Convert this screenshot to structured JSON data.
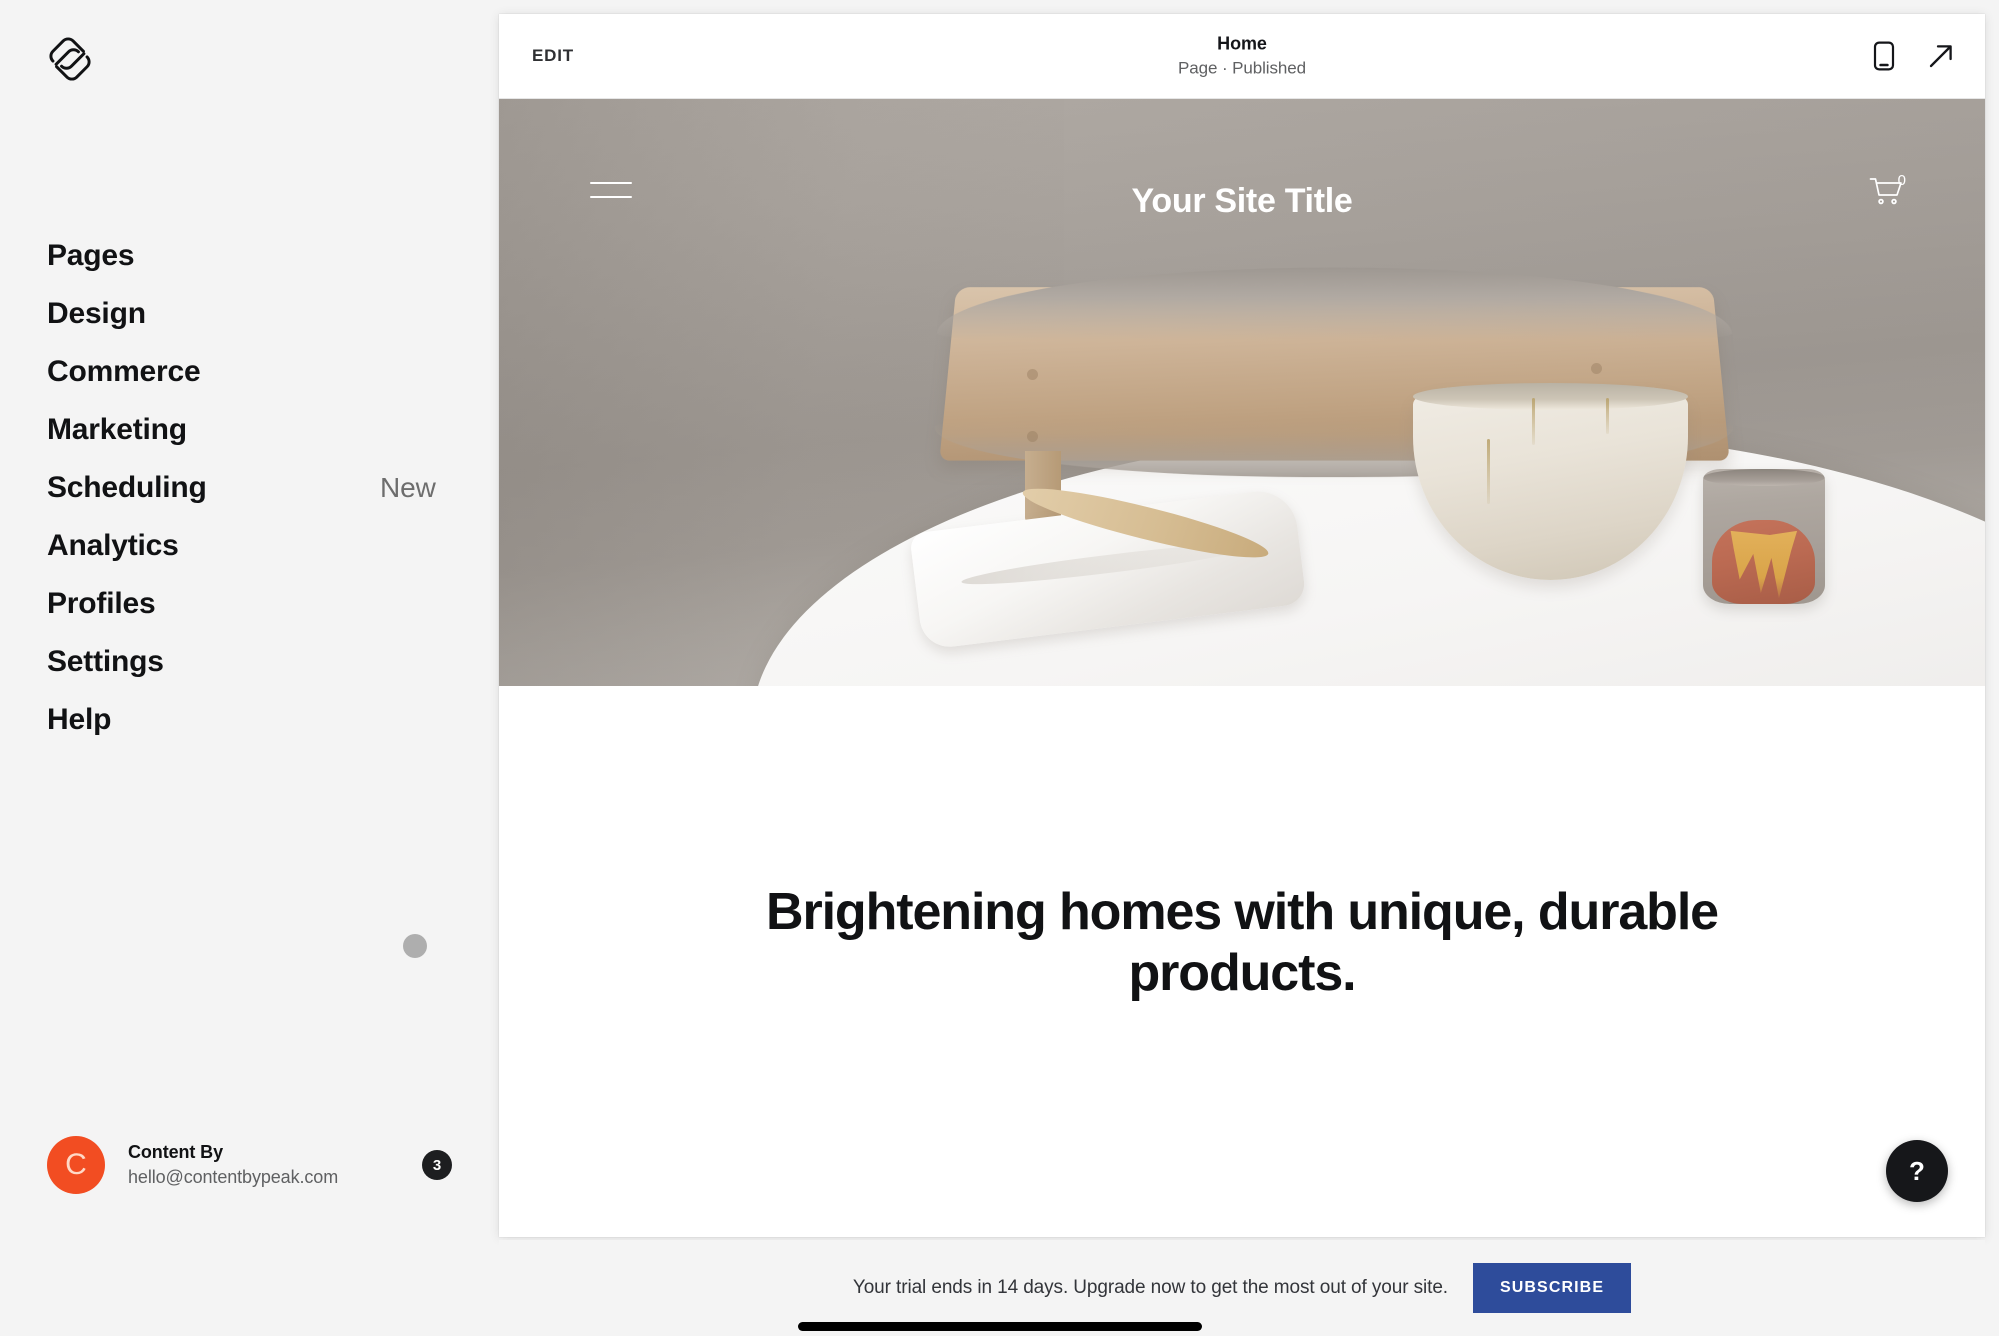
{
  "sidebar": {
    "logo_icon": "squarespace-logo-icon",
    "nav": [
      {
        "label": "Pages",
        "badge": ""
      },
      {
        "label": "Design",
        "badge": ""
      },
      {
        "label": "Commerce",
        "badge": ""
      },
      {
        "label": "Marketing",
        "badge": ""
      },
      {
        "label": "Scheduling",
        "badge": "New"
      },
      {
        "label": "Analytics",
        "badge": ""
      },
      {
        "label": "Profiles",
        "badge": ""
      },
      {
        "label": "Settings",
        "badge": ""
      },
      {
        "label": "Help",
        "badge": ""
      }
    ],
    "collapse_handle_icon": "collapse-dot-icon",
    "account": {
      "avatar_initial": "C",
      "avatar_color": "#f24d22",
      "name": "Content By",
      "email": "hello@contentbypeak.com",
      "notification_count": "3"
    }
  },
  "preview": {
    "toolbar": {
      "edit_label": "EDIT",
      "page_title": "Home",
      "page_status": "Page · Published",
      "mobile_icon": "mobile-preview-icon",
      "open_icon": "open-external-icon"
    },
    "site": {
      "menu_icon": "hamburger-menu-icon",
      "title": "Your Site Title",
      "cart_icon": "shopping-cart-icon",
      "cart_count": "0",
      "headline": "Brightening homes with unique, durable products."
    },
    "help_button_label": "?"
  },
  "trial": {
    "message": "Your trial ends in 14 days. Upgrade now to get the most out of your site.",
    "subscribe_label": "SUBSCRIBE",
    "subscribe_color": "#2e4c9b"
  }
}
